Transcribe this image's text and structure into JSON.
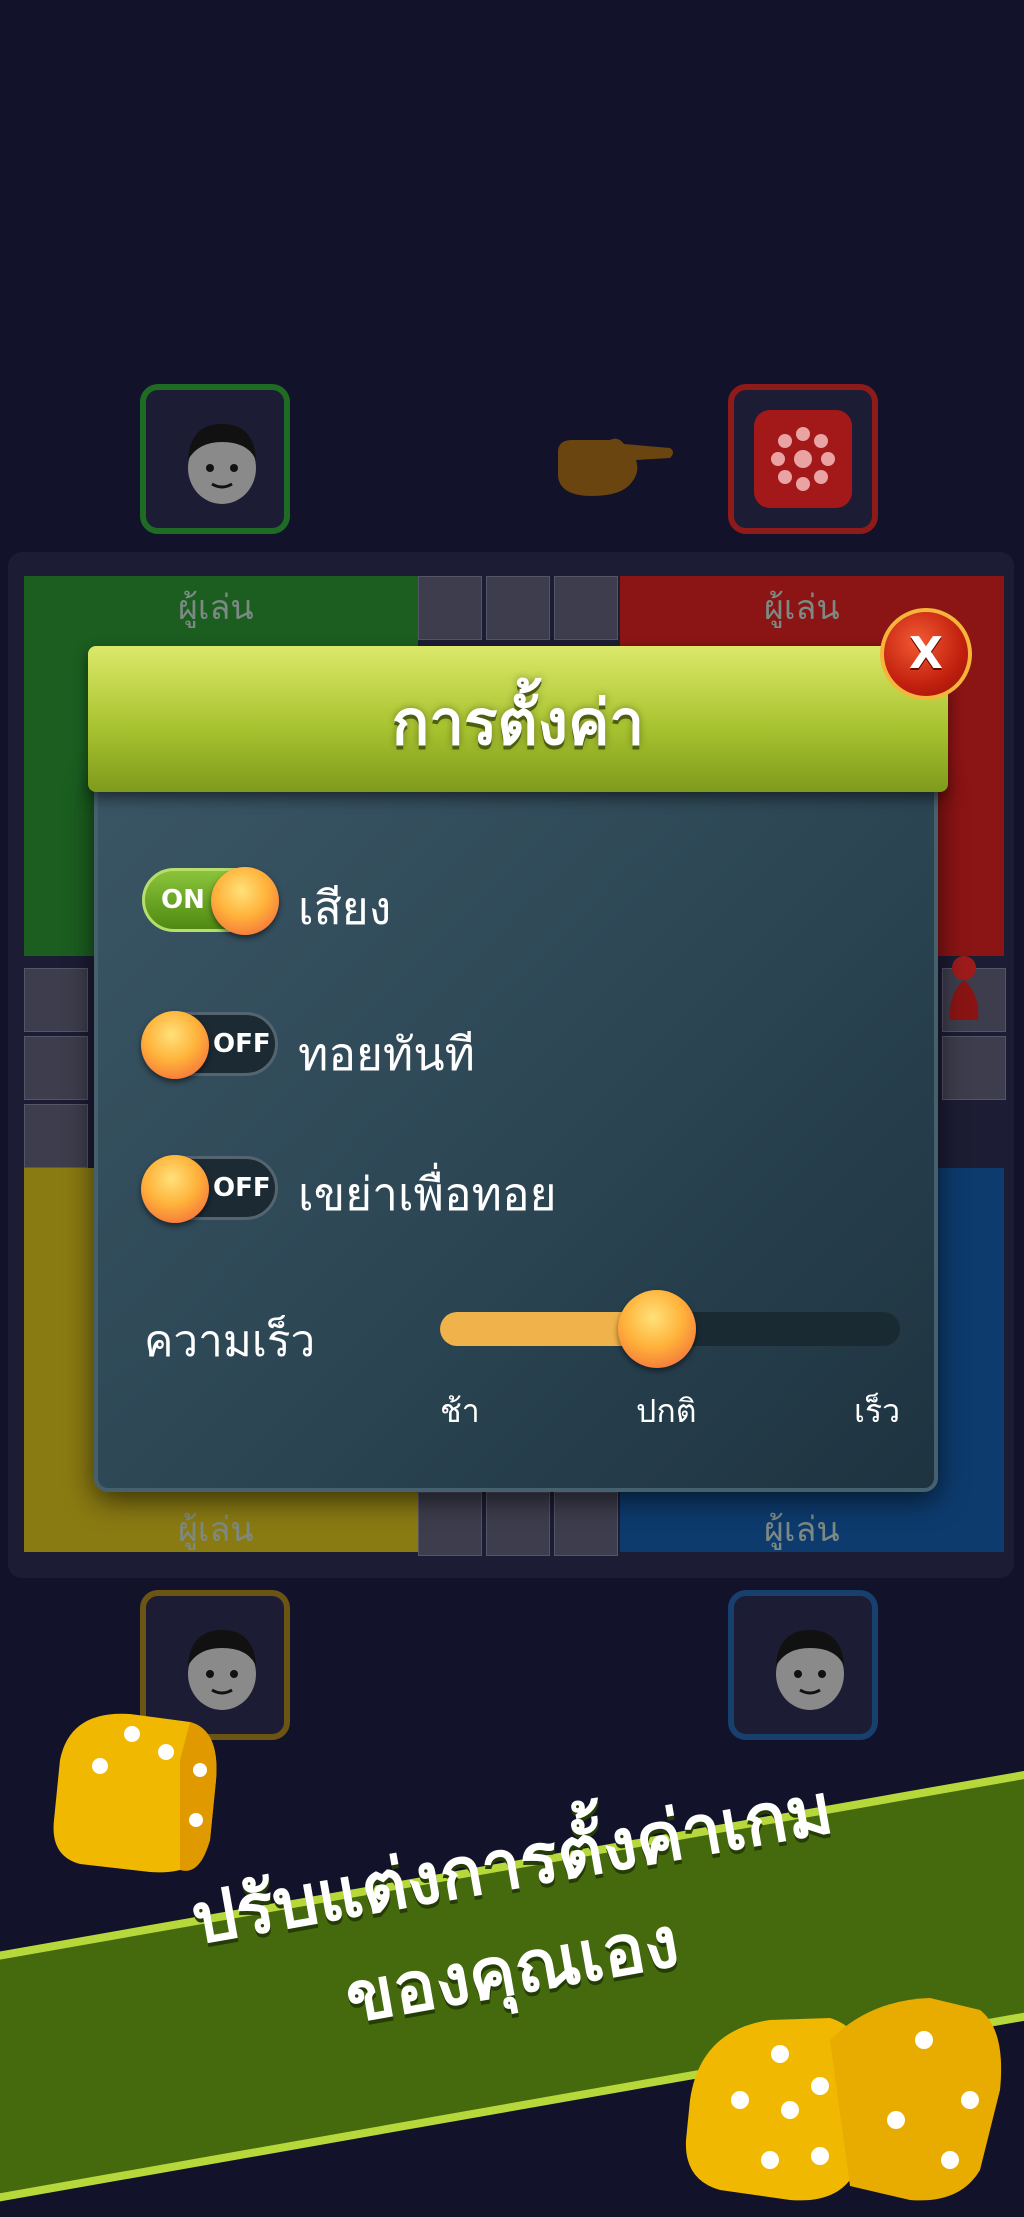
{
  "board": {
    "player_label_top_left": "ผู้เล่น",
    "player_label_top_right": "ผู้เล่น",
    "player_label_bottom_left": "ผู้เล่น",
    "player_label_bottom_right": "ผู้เล่น"
  },
  "dialog": {
    "title": "การตั้งค่า",
    "close_label": "X",
    "toggles": [
      {
        "label": "เสียง",
        "state": "ON"
      },
      {
        "label": "ทอยทันที",
        "state": "OFF"
      },
      {
        "label": "เขย่าเพื่อทอย",
        "state": "OFF"
      }
    ],
    "speed": {
      "label": "ความเร็ว",
      "value": 0.45,
      "ticks": [
        "ช้า",
        "ปกติ",
        "เร็ว"
      ]
    }
  },
  "promo": {
    "line1": "ปรับแต่งการตั้งค่าเกม",
    "line2": "ของคุณเอง"
  },
  "colors": {
    "accent": "#a9c430",
    "close": "#c2200e",
    "slider": "#f0b24a"
  }
}
